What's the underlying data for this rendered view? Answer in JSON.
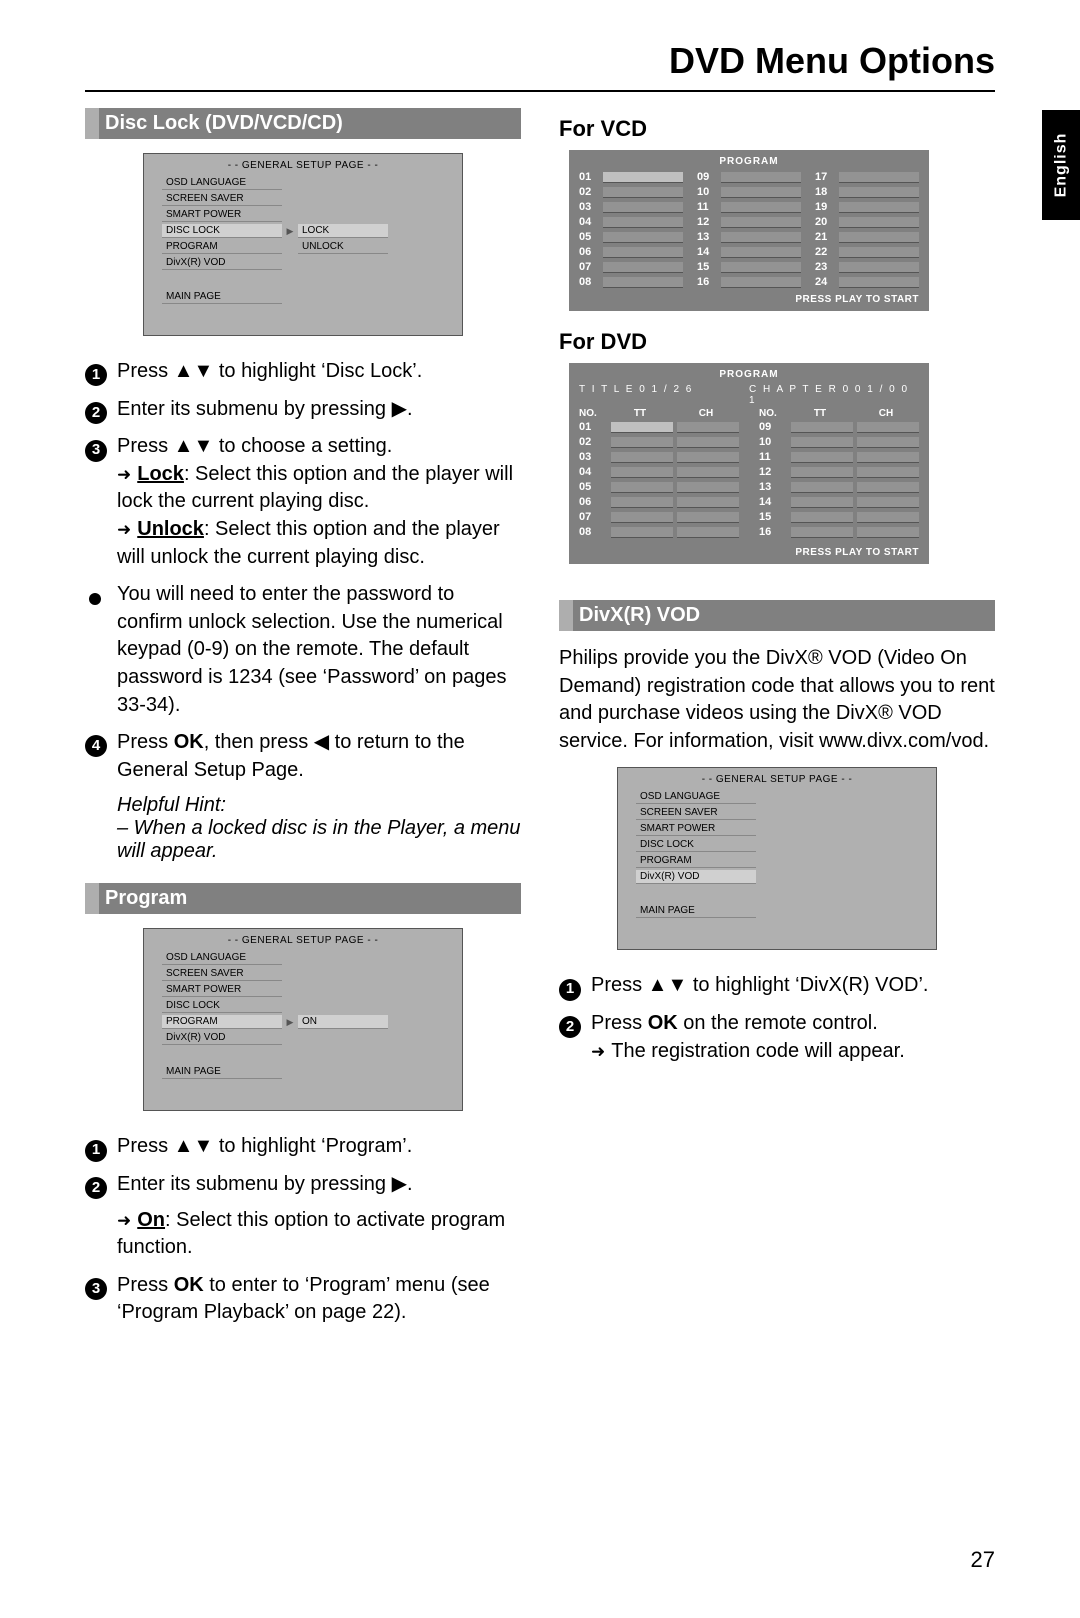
{
  "page": {
    "title": "DVD Menu Options",
    "lang_tab": "English",
    "page_number": "27"
  },
  "disc_lock": {
    "heading": "Disc Lock (DVD/VCD/CD)",
    "osd": {
      "title": "- - GENERAL SETUP PAGE - -",
      "items": [
        "OSD LANGUAGE",
        "SCREEN SAVER",
        "SMART POWER",
        "DISC LOCK",
        "PROGRAM",
        "DivX(R) VOD"
      ],
      "main": "MAIN PAGE",
      "right": [
        "LOCK",
        "UNLOCK"
      ]
    },
    "step1": "Press ▲▼ to highlight ‘Disc Lock’.",
    "step2": "Enter its submenu by pressing ▶.",
    "step3_lead": "Press ▲▼ to choose a setting.",
    "step3_lock_label": "Lock",
    "step3_lock": ": Select this option and the player will lock the current playing disc.",
    "step3_unlock_label": "Unlock",
    "step3_unlock": ": Select this option and the player will unlock the current playing disc.",
    "bullet": "You will need to enter the password to confirm unlock selection.  Use the numerical keypad (0-9) on the remote. The default password is 1234 (see ‘Password’ on pages 33-34).",
    "step4_a": "Press ",
    "step4_ok": "OK",
    "step4_b": ", then press ◀ to return to the General Setup Page.",
    "hint_label": "Helpful Hint:",
    "hint_body": "–   When a locked disc is in the Player, a menu will appear."
  },
  "program": {
    "heading": "Program",
    "osd": {
      "title": "- - GENERAL SETUP PAGE - -",
      "items": [
        "OSD LANGUAGE",
        "SCREEN SAVER",
        "SMART POWER",
        "DISC LOCK",
        "PROGRAM",
        "DivX(R) VOD"
      ],
      "main": "MAIN PAGE",
      "right_on": "ON"
    },
    "step1": "Press ▲▼ to highlight ‘Program’.",
    "step2": "Enter its submenu by pressing ▶.",
    "step2_on_label": "On",
    "step2_on": ": Select this option to activate program function.",
    "step3_a": "Press ",
    "step3_ok": "OK",
    "step3_b": " to enter to ‘Program’ menu (see ‘Program Playback’ on page 22)."
  },
  "vcd": {
    "heading": "For VCD",
    "title": "PROGRAM",
    "numbers": [
      "01",
      "02",
      "03",
      "04",
      "05",
      "06",
      "07",
      "08",
      "09",
      "10",
      "11",
      "12",
      "13",
      "14",
      "15",
      "16",
      "17",
      "18",
      "19",
      "20",
      "21",
      "22",
      "23",
      "24"
    ],
    "footer": "PRESS PLAY TO START"
  },
  "dvd": {
    "heading": "For DVD",
    "title": "PROGRAM",
    "title_info": "T I T L E 0 1 / 2 6",
    "chapter_info": "C H A P T E R 0 0 1 / 0 0 1",
    "col_no": "NO.",
    "col_tt": "TT",
    "col_ch": "CH",
    "left_nums": [
      "01",
      "02",
      "03",
      "04",
      "05",
      "06",
      "07",
      "08"
    ],
    "right_nums": [
      "09",
      "10",
      "11",
      "12",
      "13",
      "14",
      "15",
      "16"
    ],
    "footer": "PRESS PLAY TO START"
  },
  "divx": {
    "heading": "DivX(R) VOD",
    "para": "Philips provide you the DivX® VOD (Video On Demand) registration code that allows you to rent and purchase videos using the DivX® VOD service. For information, visit www.divx.com/vod.",
    "osd": {
      "title": "- - GENERAL SETUP PAGE - -",
      "items": [
        "OSD LANGUAGE",
        "SCREEN SAVER",
        "SMART POWER",
        "DISC LOCK",
        "PROGRAM",
        "DivX(R) VOD"
      ],
      "main": "MAIN PAGE"
    },
    "step1": "Press ▲▼ to highlight ‘DivX(R) VOD’.",
    "step2_a": "Press ",
    "step2_ok": "OK",
    "step2_b": " on the remote control.",
    "step2_sub": "The registration code will appear."
  }
}
